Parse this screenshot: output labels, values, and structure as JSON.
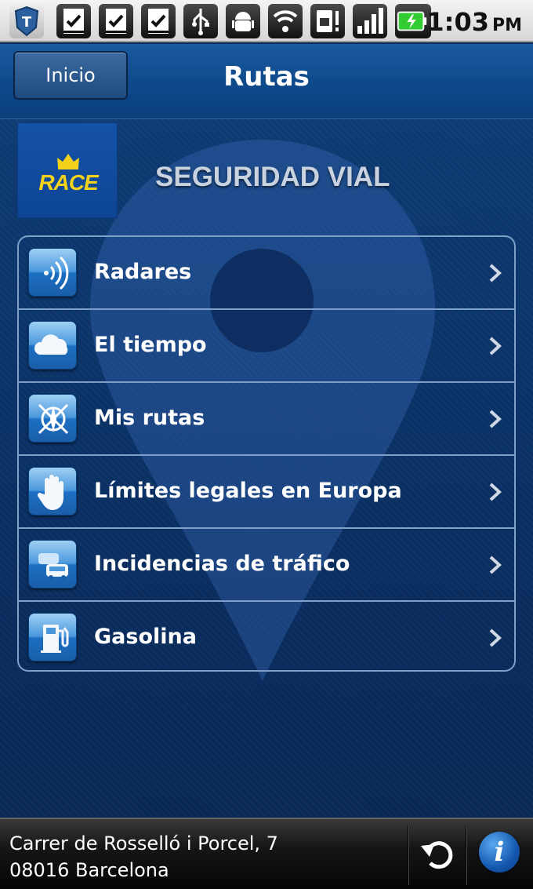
{
  "status_bar": {
    "time": "1:03",
    "ampm": "PM",
    "icons": [
      "shield-app-icon",
      "checklist-icon",
      "checklist-icon",
      "checklist-icon",
      "usb-icon",
      "android-debug-icon",
      "wifi-icon",
      "sim-alert-icon",
      "signal-icon",
      "battery-charging-icon"
    ]
  },
  "header": {
    "back_label": "Inicio",
    "title": "Rutas"
  },
  "logo": {
    "brand_short": "RACE",
    "brand_name": "SEGURIDAD VIAL"
  },
  "menu": {
    "items": [
      {
        "label": "Radares",
        "icon": "radar-icon"
      },
      {
        "label": "El tiempo",
        "icon": "cloud-icon"
      },
      {
        "label": "Mis rutas",
        "icon": "compass-icon"
      },
      {
        "label": "Límites legales en Europa",
        "icon": "hand-icon"
      },
      {
        "label": "Incidencias de tráfico",
        "icon": "traffic-icon"
      },
      {
        "label": "Gasolina",
        "icon": "fuel-pump-icon"
      }
    ]
  },
  "footer": {
    "address_line1": "Carrer de Rosselló i Porcel, 7",
    "address_line2": "08016 Barcelona",
    "info_glyph": "i"
  },
  "colors": {
    "background": "#0b2a5c",
    "header": "#0f4a8c",
    "row_border": "#7ea0c8",
    "logo_yellow": "#f2d21a"
  }
}
